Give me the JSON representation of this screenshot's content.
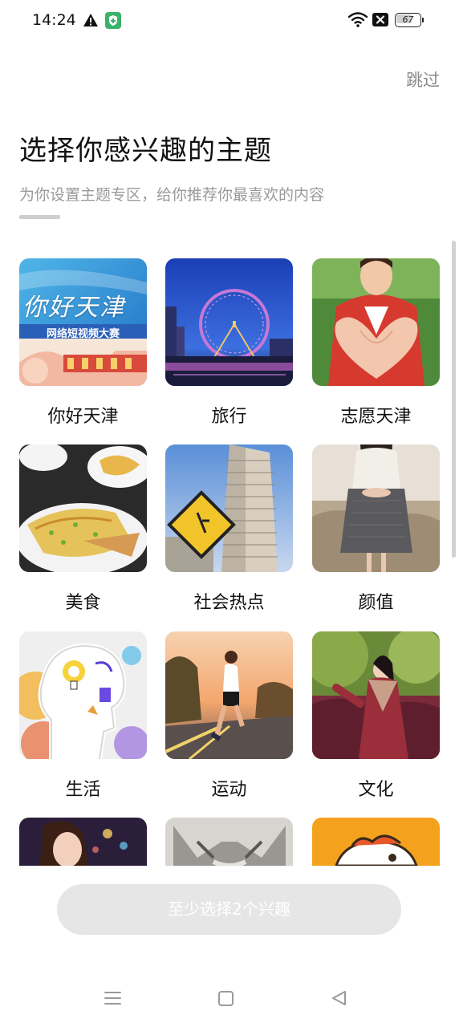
{
  "status_bar": {
    "time": "14:24",
    "battery": "67",
    "battery_level": 0.67,
    "icons": [
      "warning-icon",
      "shield-icon",
      "wifi-icon",
      "no-sim-icon",
      "battery-icon"
    ]
  },
  "header": {
    "skip_label": "跳过",
    "title": "选择你感兴趣的主题",
    "subtitle": "为你设置主题专区，给你推荐你最喜欢的内容"
  },
  "banner": {
    "calligraphy": "你好天津",
    "caption": "网络短视频大赛"
  },
  "topics": [
    {
      "label": "你好天津"
    },
    {
      "label": "旅行"
    },
    {
      "label": "志愿天津"
    },
    {
      "label": "美食"
    },
    {
      "label": "社会热点"
    },
    {
      "label": "颜值"
    },
    {
      "label": "生活"
    },
    {
      "label": "运动"
    },
    {
      "label": "文化"
    }
  ],
  "confirm_button": "至少选择2个兴趣",
  "nav": {
    "icons": [
      "menu-icon",
      "home-icon",
      "back-icon"
    ]
  },
  "colors": {
    "accent_disabled": "#e6e6e6",
    "subtitle": "#9a9a9a",
    "skip": "#8a8a8a"
  }
}
